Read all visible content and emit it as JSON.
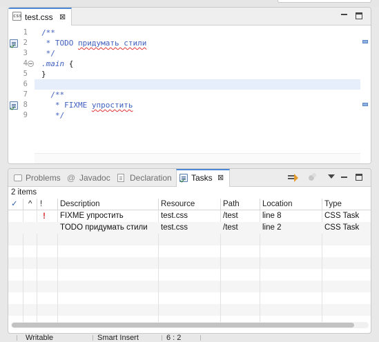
{
  "editor": {
    "tab": {
      "label": "test.css",
      "icon": "css-file-icon",
      "icon_text": "css"
    },
    "lines": [
      {
        "number": "1",
        "text": "/**"
      },
      {
        "number": "2",
        "prefix": " * TODO ",
        "squiggle": "придумать стили",
        "marker": "task-marker"
      },
      {
        "number": "3",
        "text": " */"
      },
      {
        "number": "4",
        "text": ".main",
        "rest": " {",
        "fold": true
      },
      {
        "number": "5",
        "text": "}"
      },
      {
        "number": "6",
        "text": ""
      },
      {
        "number": "7",
        "text": "  /**"
      },
      {
        "number": "8",
        "prefix": "   * FIXME ",
        "squiggle": "упростить",
        "marker": "task-marker"
      },
      {
        "number": "9",
        "text": "   */"
      }
    ]
  },
  "views": {
    "tabs": [
      {
        "label": "Problems",
        "icon": "problems-icon",
        "active": false
      },
      {
        "label": "Javadoc",
        "icon": "javadoc-icon",
        "icon_glyph": "@",
        "active": false
      },
      {
        "label": "Declaration",
        "icon": "declaration-icon",
        "active": false
      },
      {
        "label": "Tasks",
        "icon": "tasks-icon",
        "active": true
      }
    ],
    "items_count": "2 items"
  },
  "tasks_table": {
    "header": {
      "completed": "✓",
      "sort": "^",
      "priority": "!",
      "description": "Description",
      "resource": "Resource",
      "path": "Path",
      "location": "Location",
      "type": "Type"
    },
    "rows": [
      {
        "priority": "!",
        "description": "FIXME упростить",
        "resource": "test.css",
        "path": "/test",
        "location": "line 8",
        "type": "CSS Task"
      },
      {
        "priority": "",
        "description": "TODO придумать стили",
        "resource": "test.css",
        "path": "/test",
        "location": "line 2",
        "type": "CSS Task"
      }
    ]
  },
  "status_bar": {
    "mode": "Writable",
    "insert": "Smart Insert",
    "position": "6 : 2"
  },
  "colors": {
    "comment": "#3f5fbf",
    "accent": "#4a88d6",
    "error": "#d32f2f",
    "current_line": "#e6eefc"
  }
}
